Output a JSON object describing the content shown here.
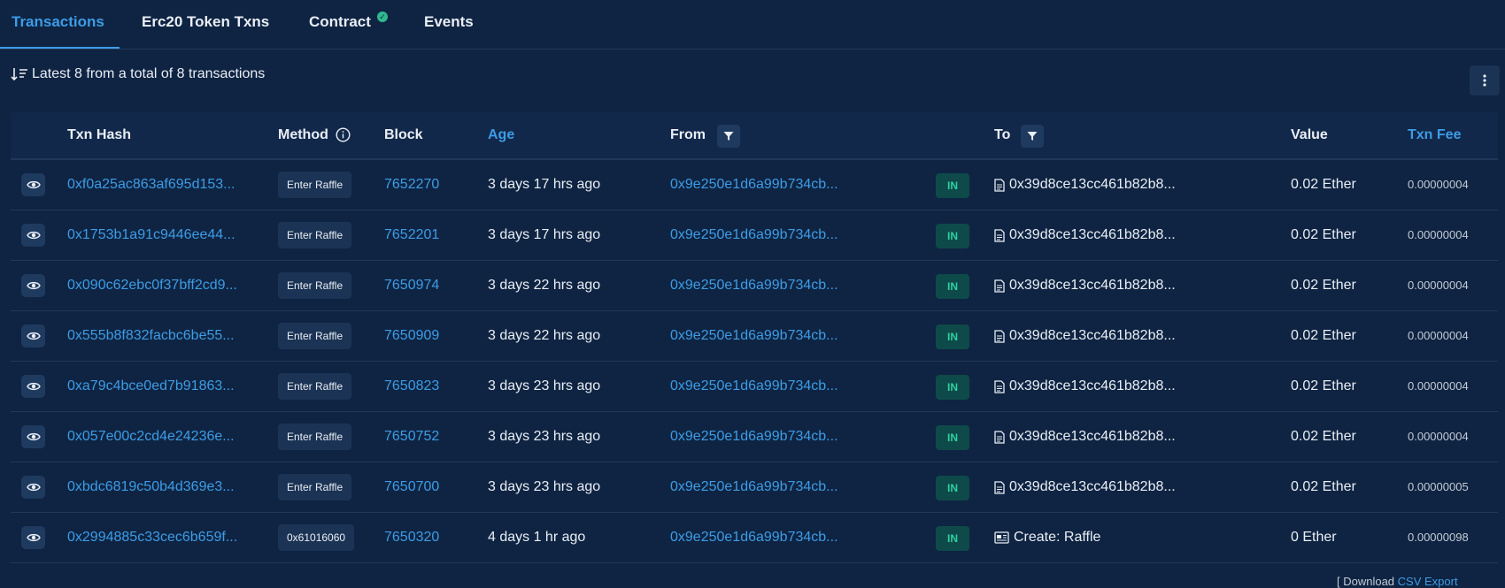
{
  "tabs": [
    {
      "label": "Transactions",
      "active": true
    },
    {
      "label": "Erc20 Token Txns",
      "active": false
    },
    {
      "label": "Contract",
      "active": false,
      "verified": true
    },
    {
      "label": "Events",
      "active": false
    }
  ],
  "summary": "Latest 8 from a total of 8 transactions",
  "columns": {
    "txn_hash": "Txn Hash",
    "method": "Method",
    "block": "Block",
    "age": "Age",
    "from": "From",
    "to": "To",
    "value": "Value",
    "txn_fee": "Txn Fee"
  },
  "rows": [
    {
      "hash": "0xf0a25ac863af695d153...",
      "method": "Enter Raffle",
      "block": "7652270",
      "age": "3 days 17 hrs ago",
      "from": "0x9e250e1d6a99b734cb...",
      "direction": "IN",
      "to": "0x39d8ce13cc461b82b8...",
      "to_icon": "contract-file-icon",
      "value": "0.02 Ether",
      "fee": "0.00000004"
    },
    {
      "hash": "0x1753b1a91c9446ee44...",
      "method": "Enter Raffle",
      "block": "7652201",
      "age": "3 days 17 hrs ago",
      "from": "0x9e250e1d6a99b734cb...",
      "direction": "IN",
      "to": "0x39d8ce13cc461b82b8...",
      "to_icon": "contract-file-icon",
      "value": "0.02 Ether",
      "fee": "0.00000004"
    },
    {
      "hash": "0x090c62ebc0f37bff2cd9...",
      "method": "Enter Raffle",
      "block": "7650974",
      "age": "3 days 22 hrs ago",
      "from": "0x9e250e1d6a99b734cb...",
      "direction": "IN",
      "to": "0x39d8ce13cc461b82b8...",
      "to_icon": "contract-file-icon",
      "value": "0.02 Ether",
      "fee": "0.00000004"
    },
    {
      "hash": "0x555b8f832facbc6be55...",
      "method": "Enter Raffle",
      "block": "7650909",
      "age": "3 days 22 hrs ago",
      "from": "0x9e250e1d6a99b734cb...",
      "direction": "IN",
      "to": "0x39d8ce13cc461b82b8...",
      "to_icon": "contract-file-icon",
      "value": "0.02 Ether",
      "fee": "0.00000004"
    },
    {
      "hash": "0xa79c4bce0ed7b91863...",
      "method": "Enter Raffle",
      "block": "7650823",
      "age": "3 days 23 hrs ago",
      "from": "0x9e250e1d6a99b734cb...",
      "direction": "IN",
      "to": "0x39d8ce13cc461b82b8...",
      "to_icon": "contract-file-icon",
      "value": "0.02 Ether",
      "fee": "0.00000004"
    },
    {
      "hash": "0x057e00c2cd4e24236e...",
      "method": "Enter Raffle",
      "block": "7650752",
      "age": "3 days 23 hrs ago",
      "from": "0x9e250e1d6a99b734cb...",
      "direction": "IN",
      "to": "0x39d8ce13cc461b82b8...",
      "to_icon": "contract-file-icon",
      "value": "0.02 Ether",
      "fee": "0.00000004"
    },
    {
      "hash": "0xbdc6819c50b4d369e3...",
      "method": "Enter Raffle",
      "block": "7650700",
      "age": "3 days 23 hrs ago",
      "from": "0x9e250e1d6a99b734cb...",
      "direction": "IN",
      "to": "0x39d8ce13cc461b82b8...",
      "to_icon": "contract-file-icon",
      "value": "0.02 Ether",
      "fee": "0.00000005"
    },
    {
      "hash": "0x2994885c33cec6b659f...",
      "method": "0x61016060",
      "block": "7650320",
      "age": "4 days 1 hr ago",
      "from": "0x9e250e1d6a99b734cb...",
      "direction": "IN",
      "to": "Create: Raffle",
      "to_icon": "contract-creation-icon",
      "value": "0 Ether",
      "fee": "0.00000098"
    }
  ],
  "colors": {
    "background": "#0f2442",
    "link": "#3d9ce6",
    "in_badge_bg": "#0e4a4a",
    "in_badge_text": "#2fd0a0"
  }
}
